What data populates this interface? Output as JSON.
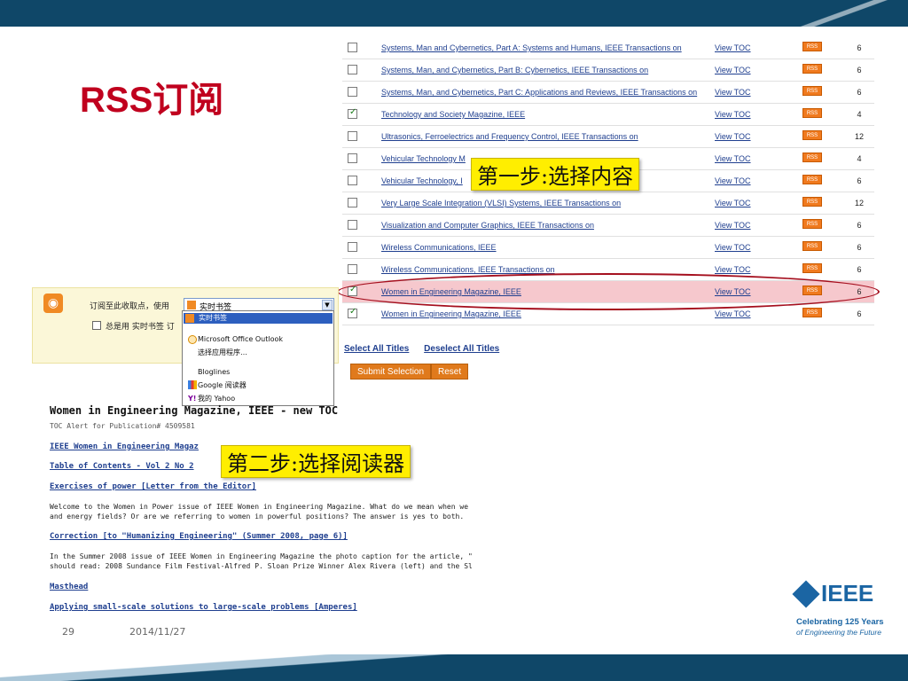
{
  "slide": {
    "title": "RSS订阅",
    "page_number": "29",
    "date": "2014/11/27"
  },
  "callouts": {
    "step1": "第一步:选择内容",
    "step2": "第二步:选择阅读器"
  },
  "toc": {
    "view_label": "View TOC",
    "rss_label": "RSS",
    "rows": [
      {
        "title": "Systems, Man and Cybernetics, Part A: Systems and Humans, IEEE Transactions on",
        "count": "6",
        "checked": false
      },
      {
        "title": "Systems, Man, and Cybernetics, Part B: Cybernetics, IEEE Transactions on",
        "count": "6",
        "checked": false
      },
      {
        "title": "Systems, Man, and Cybernetics, Part C: Applications and Reviews, IEEE Transactions on",
        "count": "6",
        "checked": false
      },
      {
        "title": "Technology and Society Magazine, IEEE",
        "count": "4",
        "checked": true
      },
      {
        "title": "Ultrasonics, Ferroelectrics and Frequency Control, IEEE Transactions on",
        "count": "12",
        "checked": false
      },
      {
        "title": "Vehicular Technology M",
        "count": "4",
        "checked": false
      },
      {
        "title": "Vehicular Technology, I",
        "count": "6",
        "checked": false
      },
      {
        "title": "Very Large Scale Integration (VLSI) Systems, IEEE Transactions on",
        "count": "12",
        "checked": false
      },
      {
        "title": "Visualization and Computer Graphics, IEEE Transactions on",
        "count": "6",
        "checked": false
      },
      {
        "title": "Wireless Communications, IEEE",
        "count": "6",
        "checked": false
      },
      {
        "title": "Wireless Communications, IEEE Transactions on",
        "count": "6",
        "checked": false
      },
      {
        "title": "Women in Engineering Magazine, IEEE",
        "count": "6",
        "checked": true,
        "highlight": true
      },
      {
        "title": "Women in Engineering Magazine, IEEE",
        "count": "6",
        "checked": true
      }
    ],
    "select_all": "Select All Titles",
    "deselect_all": "Deselect All Titles",
    "submit_label": "Submit Selection",
    "reset_label": "Reset"
  },
  "reader": {
    "subscribe_label": "订阅至此收取点，使用",
    "selected": "实时书签",
    "always_use_label": "总是用 实时书签 订",
    "options": [
      "实时书签",
      "Microsoft Office Outlook",
      "选择应用程序…",
      "Bloglines",
      "Google 阅读器",
      "我的 Yahoo"
    ]
  },
  "email": {
    "heading": "Women in Engineering Magazine, IEEE - new TOC",
    "alert": "TOC Alert for Publication# 4509581",
    "link1": "IEEE Women in Engineering Magaz",
    "link2": "Table of Contents - Vol 2 No 2",
    "link3": "Exercises of power [Letter from the Editor]",
    "text1": "Welcome to the Women in Power issue of IEEE Women in Engineering Magazine. What do we mean when we",
    "text2": "and energy fields? Or are we referring to women in powerful positions? The answer is yes to both.",
    "link4": "Correction [to \"Humanizing Engineering\" (Summer 2008, page 6)]",
    "text3": "In the Summer 2008 issue of IEEE Women in Engineering Magazine the photo caption for the article, \"",
    "text4": "should read: 2008 Sundance Film Festival-Alfred P. Sloan Prize Winner Alex Rivera (left) and the Sl",
    "link5": "Masthead",
    "link6": "Applying small-scale solutions to large-scale problems [Amperes]"
  },
  "ieee": {
    "name": "IEEE",
    "tagline1": "Celebrating 125 Years",
    "tagline2": "of Engineering the Future"
  },
  "colors": {
    "title_red": "#c0001e",
    "band_navy": "#0f4768",
    "ieee_blue": "#1b65a3",
    "rss_orange": "#f07a1e",
    "highlight_red": "#a50f1e",
    "callout_yellow": "#ffee00"
  }
}
